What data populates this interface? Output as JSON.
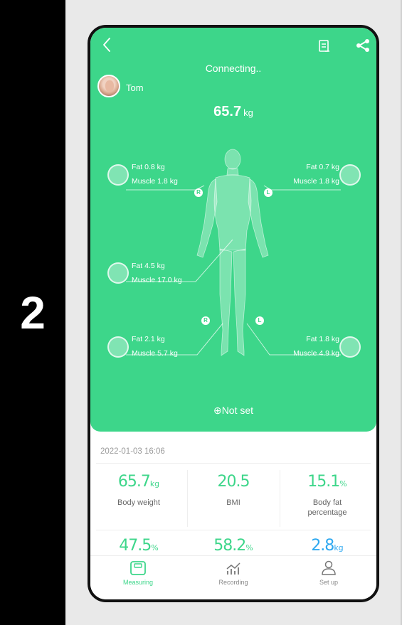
{
  "step_number": "2",
  "header": {
    "status": "Connecting..",
    "user_name": "Tom",
    "weight_value": "65.7",
    "weight_unit": "kg"
  },
  "segments": {
    "left_arm": {
      "fat": "Fat 0.8 kg",
      "muscle": "Muscle 1.8 kg",
      "side_marker": "R"
    },
    "right_arm": {
      "fat": "Fat 0.7 kg",
      "muscle": "Muscle 1.8 kg",
      "side_marker": "L"
    },
    "trunk": {
      "fat": "Fat 4.5 kg",
      "muscle": "Muscle 17.0 kg"
    },
    "left_leg": {
      "fat": "Fat 2.1 kg",
      "muscle": "Muscle 5.7 kg",
      "side_marker": "R"
    },
    "right_leg": {
      "fat": "Fat 1.8 kg",
      "muscle": "Muscle 4.9 kg",
      "side_marker": "L"
    }
  },
  "not_set_label": "Not set",
  "measurement_date": "2022-01-03 16:06",
  "metrics": [
    {
      "value": "65.7",
      "unit": "kg",
      "label": "Body weight"
    },
    {
      "value": "20.5",
      "unit": "",
      "label": "BMI"
    },
    {
      "value": "15.1",
      "unit": "%",
      "label": "Body fat percentage"
    },
    {
      "value": "47.5",
      "unit": "%",
      "label": ""
    },
    {
      "value": "58.2",
      "unit": "%",
      "label": ""
    },
    {
      "value": "2.8",
      "unit": "kg",
      "label": ""
    }
  ],
  "tabs": [
    {
      "label": "Measuring",
      "icon": "scale-icon",
      "active": true
    },
    {
      "label": "Recording",
      "icon": "chart-icon",
      "active": false
    },
    {
      "label": "Set up",
      "icon": "person-icon",
      "active": false
    }
  ],
  "colors": {
    "accent": "#3dd68a",
    "accent_blue": "#2ea8f0",
    "frame": "#111111"
  }
}
